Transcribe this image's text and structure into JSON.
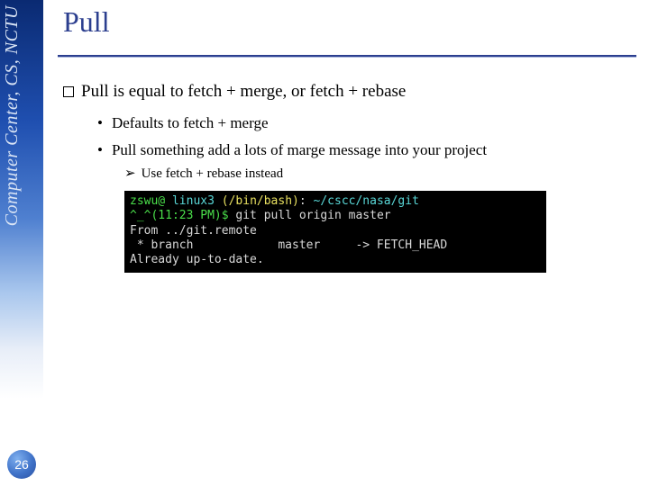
{
  "sidebar": {
    "org_text": "Computer Center, CS, NCTU"
  },
  "page_number": "26",
  "slide": {
    "title": "Pull",
    "main_bullet": "Pull is equal to fetch + merge, or fetch + rebase",
    "sub1": "Defaults to fetch + merge",
    "sub2": "Pull something add a lots of marge message into your project",
    "sub2a": "Use fetch + rebase instead"
  },
  "terminal": {
    "user": "zswu@",
    "host": " linux3 ",
    "shell": "(/bin/bash)",
    "sep": ": ",
    "path": "~/cscc/nasa/git",
    "prompt_line2": "^_^(11:23 PM)$ ",
    "cmd": "git pull origin master",
    "out_from": "From ../git.remote",
    "out_branch": " * branch            master     -> FETCH_HEAD",
    "out_done": "Already up-to-date."
  }
}
